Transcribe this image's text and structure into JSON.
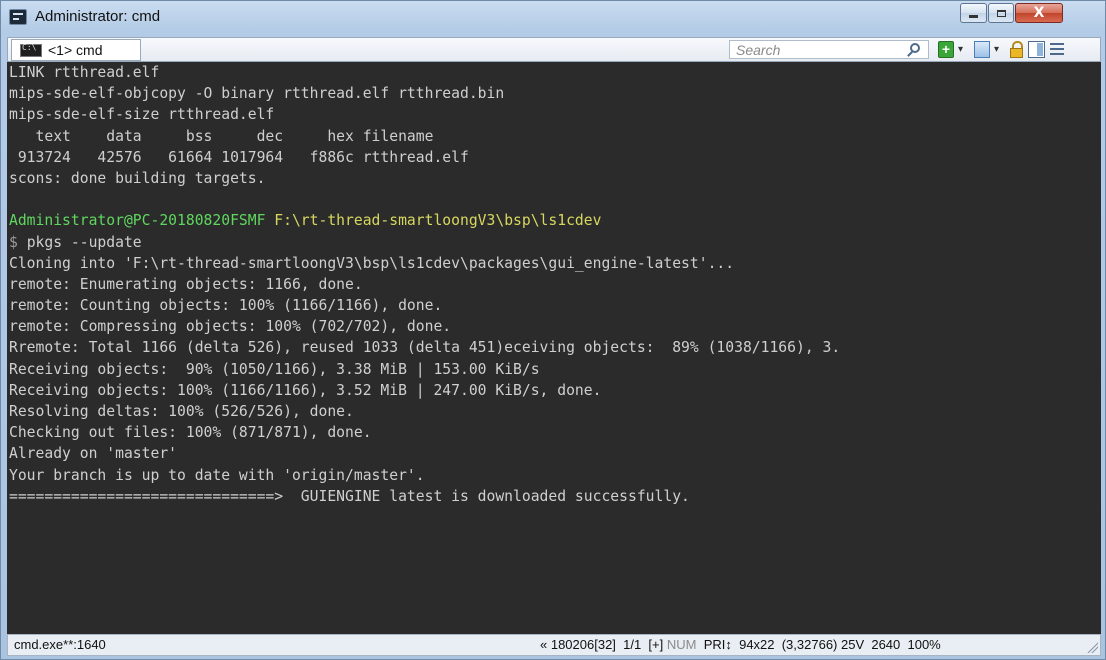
{
  "window": {
    "title": "Administrator: cmd",
    "controls": {
      "minimize": "minimize",
      "maximize": "maximize",
      "close": "X"
    }
  },
  "toolbar": {
    "tab_label": "<1> cmd",
    "search_placeholder": "Search",
    "buttons": [
      "plus-icon",
      "dropdown-arrow",
      "window-icon",
      "dropdown-arrow",
      "lock-icon",
      "pane-icon",
      "menu-icon"
    ],
    "dropdown_glyph": "▾"
  },
  "console": {
    "lines": [
      [
        {
          "t": "LINK rtthread.elf"
        }
      ],
      [
        {
          "t": "mips-sde-elf-objcopy -O binary rtthread.elf rtthread.bin"
        }
      ],
      [
        {
          "t": "mips-sde-elf-size rtthread.elf"
        }
      ],
      [
        {
          "t": "   text    data     bss     dec     hex filename"
        }
      ],
      [
        {
          "t": " 913724   42576   61664 1017964   f886c rtthread.elf"
        }
      ],
      [
        {
          "t": "scons: done building targets."
        }
      ],
      [
        {
          "t": ""
        }
      ],
      [
        {
          "t": "Administrator@PC-20180820FSMF ",
          "c": "green"
        },
        {
          "t": "F:\\rt-thread-smartloongV3\\bsp\\ls1cdev",
          "c": "yellow"
        }
      ],
      [
        {
          "t": "$ ",
          "c": "grey"
        },
        {
          "t": "pkgs --update"
        }
      ],
      [
        {
          "t": "Cloning into 'F:\\rt-thread-smartloongV3\\bsp\\ls1cdev\\packages\\gui_engine-latest'..."
        }
      ],
      [
        {
          "t": "remote: Enumerating objects: 1166, done."
        }
      ],
      [
        {
          "t": "remote: Counting objects: 100% (1166/1166), done."
        }
      ],
      [
        {
          "t": "remote: Compressing objects: 100% (702/702), done."
        }
      ],
      [
        {
          "t": "Rremote: Total 1166 (delta 526), reused 1033 (delta 451)eceiving objects:  89% (1038/1166), 3."
        }
      ],
      [
        {
          "t": "Receiving objects:  90% (1050/1166), 3.38 MiB | 153.00 KiB/s"
        }
      ],
      [
        {
          "t": "Receiving objects: 100% (1166/1166), 3.52 MiB | 247.00 KiB/s, done."
        }
      ],
      [
        {
          "t": "Resolving deltas: 100% (526/526), done."
        }
      ],
      [
        {
          "t": "Checking out files: 100% (871/871), done."
        }
      ],
      [
        {
          "t": "Already on 'master'"
        }
      ],
      [
        {
          "t": "Your branch is up to date with 'origin/master'."
        }
      ],
      [
        {
          "t": "==============================>  GUIENGINE latest is downloaded successfully."
        }
      ]
    ]
  },
  "status": {
    "left": "cmd.exe**:1640",
    "segments": [
      {
        "t": "« 180206[32]  1/1  [+] "
      },
      {
        "t": "NUM",
        "c": "num"
      },
      {
        "t": "  PRI↕  94x22  (3,32766) 25V  2640  100%"
      }
    ]
  },
  "colors": {
    "console_bg": "#2b2b2b",
    "console_text": "#cfcfcf",
    "prompt_user": "#5fd75f",
    "prompt_path": "#d7d75f"
  }
}
